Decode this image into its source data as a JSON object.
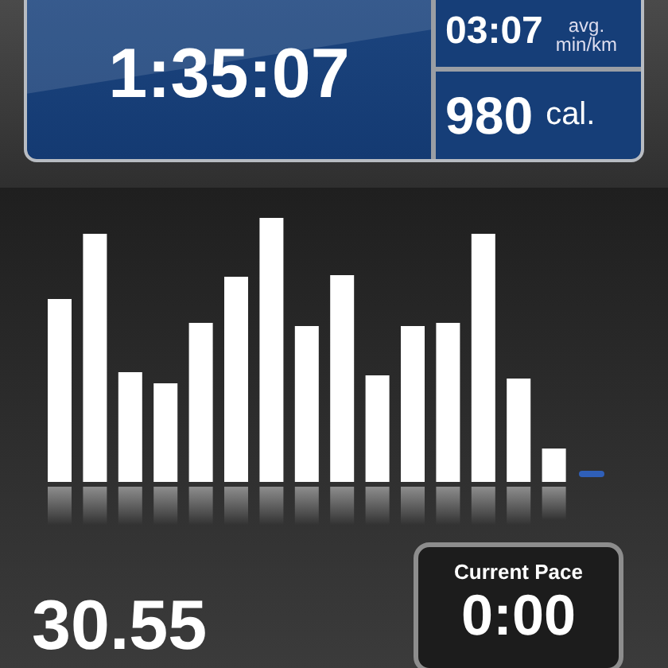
{
  "summary": {
    "time": "1:35:07",
    "pace": {
      "value": "03:07",
      "unit_top": "avg.",
      "unit_bottom": "min/km"
    },
    "calories": {
      "value": "980",
      "unit": "cal."
    }
  },
  "distance": "30.55",
  "current_pace": {
    "label": "Current Pace",
    "value": "0:00"
  }
}
